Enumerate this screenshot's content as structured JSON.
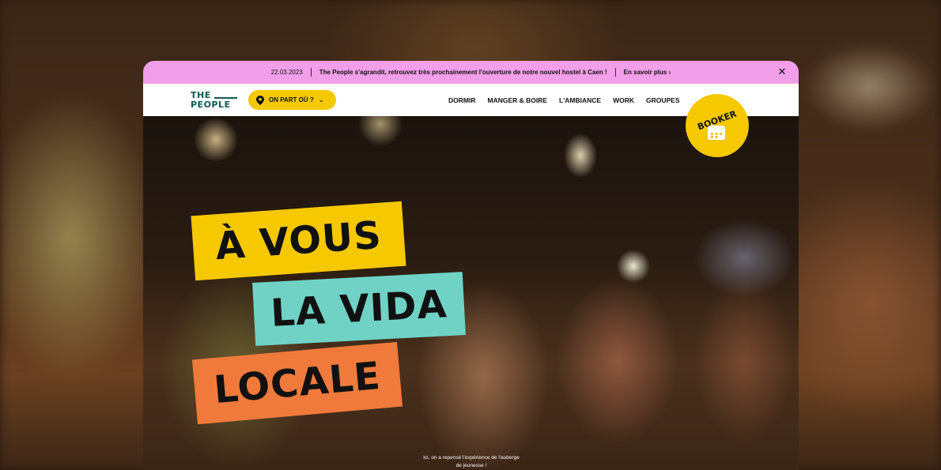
{
  "announcement": {
    "date": "22.03.2023",
    "message": "The People s'agrandit, retrouvez très prochainement l'ouverture de notre nouvel hostel à Caen !",
    "link_label": "En savoir plus ›",
    "close_label": "✕"
  },
  "logo": {
    "line1": "THE",
    "line2": "PEOPLE"
  },
  "where_button": {
    "label": "ON PART OÙ ?",
    "chevron": "⌄"
  },
  "nav": {
    "items": [
      {
        "label": "DORMIR"
      },
      {
        "label": "MANGER & BOIRE"
      },
      {
        "label": "L'AMBIANCE"
      },
      {
        "label": "WORK"
      },
      {
        "label": "GROUPES"
      }
    ]
  },
  "booker": {
    "label": "BOOKER"
  },
  "hero": {
    "headline_1": "À VOUS",
    "headline_2": "LA VIDA",
    "headline_3": "LOCALE",
    "tagline": "Ici, on a repensé l'expérience de l'auberge de jeunesse !",
    "scroll_arrow": "↓"
  },
  "colors": {
    "announce_bg": "#f29ee8",
    "brand_yellow": "#f5c800",
    "brand_teal": "#6fd2c5",
    "brand_orange": "#f07a3b",
    "logo_green": "#0f5a52"
  },
  "icons": {
    "pin": "map-pin-icon",
    "calendar": "calendar-icon"
  }
}
